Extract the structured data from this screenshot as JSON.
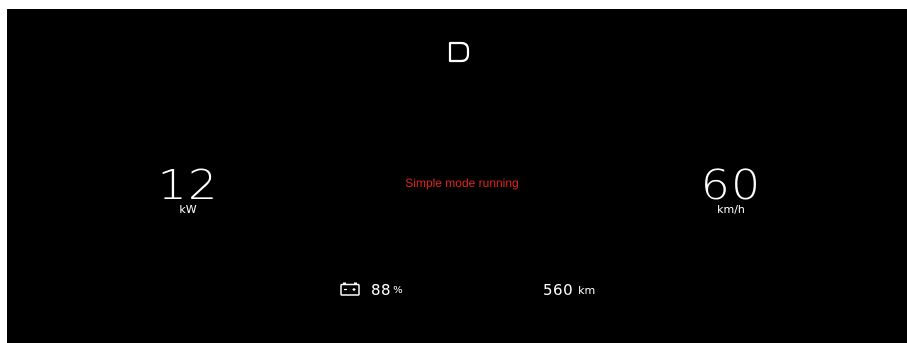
{
  "gear": {
    "value": "D"
  },
  "power": {
    "value": "12",
    "unit": "kW"
  },
  "speed": {
    "value": "60",
    "unit": "km/h"
  },
  "status": {
    "message": "Simple mode running",
    "color": "#e0281e"
  },
  "battery": {
    "icon": "battery-icon",
    "value": "88",
    "unit": "%"
  },
  "range": {
    "value": "560",
    "unit": "km"
  }
}
